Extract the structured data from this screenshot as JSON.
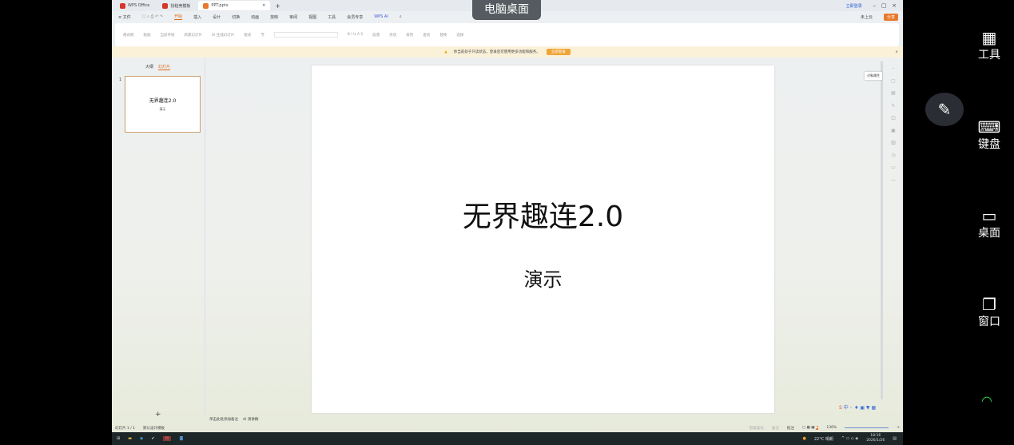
{
  "titlebar": {
    "tabs": [
      {
        "label": "WPS Office",
        "color": "#d6372b"
      },
      {
        "label": "找稻壳模板",
        "color": "#d6372b"
      },
      {
        "label": "PPT.pptx",
        "color": "#e8792b",
        "active": true
      }
    ],
    "new_tab": "+",
    "account": "立即登录"
  },
  "overlay_label": "电脑桌面",
  "menu": {
    "file": "≡ 文件",
    "items": [
      "开始",
      "插入",
      "设计",
      "切换",
      "动画",
      "放映",
      "审阅",
      "视图",
      "工具",
      "会员专享",
      "WPS AI"
    ],
    "active": "开始",
    "unsaved": "未上云",
    "share": "分享"
  },
  "ribbon": {
    "groups": [
      "格式刷",
      "粘贴",
      "当前开始",
      "新建幻灯片",
      "AI 生成幻灯片",
      "版式",
      "节",
      "B I U A S",
      "段落",
      "形状",
      "排列",
      "查找",
      "替换",
      "选择"
    ]
  },
  "notice": {
    "text": "你当前处于只读状态，登录后可使用更多功能和服务。",
    "button": "立即登录",
    "accent": "#f0a53a"
  },
  "left_panel": {
    "tabs": [
      "大纲",
      "幻灯片"
    ],
    "active": "幻灯片",
    "slide_number": "1",
    "add": "+"
  },
  "slide": {
    "title": "无界趣连2.0",
    "subtitle": "演示"
  },
  "right_toolbar": {
    "tooltip": "对象属性"
  },
  "notes": {
    "placeholder": "单击此处添加备注",
    "ai": "AI 演讲稿"
  },
  "status": {
    "slide_count": "幻灯片 1 / 1",
    "theme": "默认设计模板",
    "smart": "智能美化",
    "notes": "备注",
    "comment": "批注",
    "zoom": "136%"
  },
  "taskbar": {
    "weather": "22°C 晴朗",
    "time": "18:16",
    "date": "2026/1/26"
  },
  "side_panel": {
    "items": [
      {
        "icon": "grid-icon",
        "label": "工具"
      },
      {
        "icon": "keyboard-icon",
        "label": "键盘"
      },
      {
        "icon": "monitor-icon",
        "label": "桌面"
      },
      {
        "icon": "windows-icon",
        "label": "窗口"
      }
    ]
  }
}
